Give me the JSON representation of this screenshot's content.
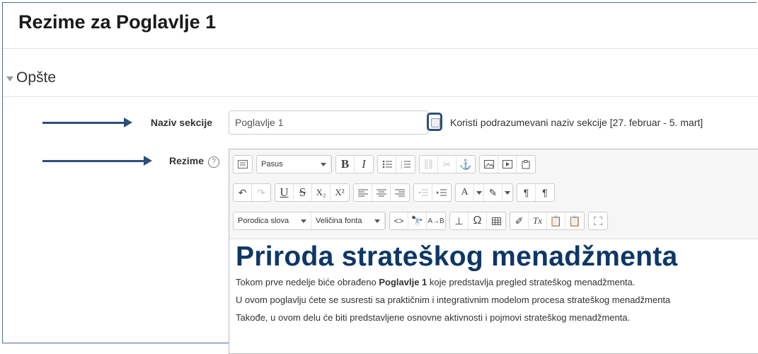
{
  "page": {
    "title": "Rezime za Poglavlje 1",
    "section_title": "Opšte"
  },
  "form": {
    "section_name_label": "Naziv sekcije",
    "section_name_value": "Poglavlje 1",
    "use_default_label": "Koristi podrazumevani naziv sekcije [27. februar - 5. mart]",
    "summary_label": "Rezime",
    "help_glyph": "?"
  },
  "toolbar": {
    "paragraph_select": "Pasus",
    "font_family_select": "Porodica slova",
    "font_size_select": "Veličina fonta",
    "bold": "B",
    "italic": "I",
    "underline": "U",
    "strike": "S",
    "subscript": "X₂",
    "superscript": "X²",
    "text_color": "A",
    "omega": "Ω",
    "code": "<>",
    "clear": "Tx"
  },
  "content": {
    "heading": "Priroda strateškog menadžmenta",
    "p1_before": "Tokom prve nedelje biće obrađeno ",
    "p1_bold": "Poglavlje 1",
    "p1_after": " koje predstavlja pregled strateškog menadžmenta.",
    "p2": "U ovom poglavlju ćete se susresti sa praktičnim i integrativnim modelom procesa strateškog menadžmenta",
    "p3": "Takođe, u ovom delu će biti predstavljene osnovne aktivnosti i pojmovi strateškog menadžmenta."
  },
  "colors": {
    "annotation_arrow": "#2d4f7c",
    "heading": "#0e3766"
  }
}
